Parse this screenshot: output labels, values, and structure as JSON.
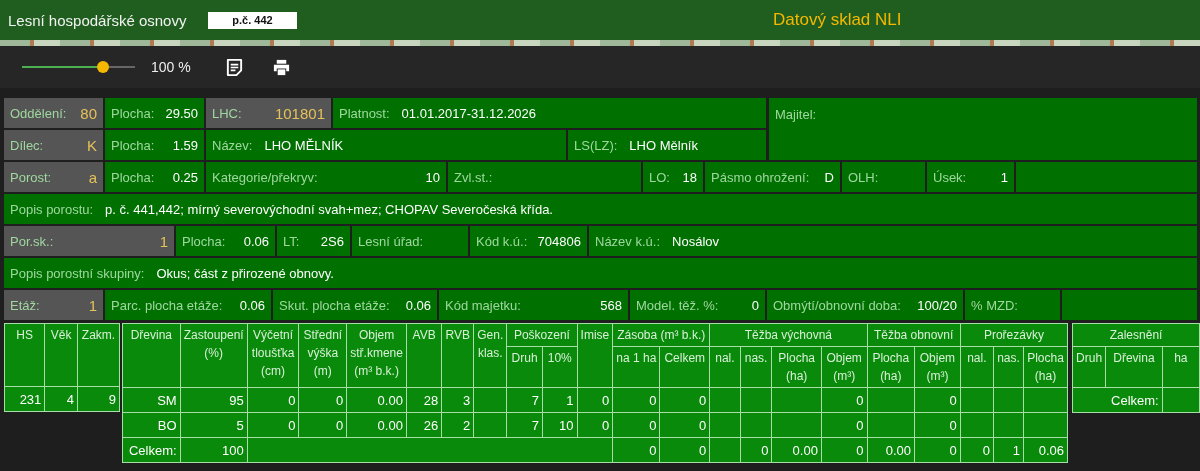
{
  "header": {
    "title": "Lesní hospodářské osnovy",
    "badge": "p.č. 442",
    "app_title": "Datový sklad NLI"
  },
  "toolbar": {
    "zoom": {
      "level": 0.72
    },
    "zoom_reading": "100 %"
  },
  "info": {
    "owner": {
      "label": "Majitel:"
    },
    "lines": [
      {
        "fields": [
          {
            "kind": "key",
            "label": "Oddělení:",
            "value": "80"
          },
          {
            "kind": "field",
            "label": "Plocha:",
            "value": "29.50"
          },
          {
            "kind": "key",
            "label": "LHC:",
            "value": "101801"
          },
          {
            "kind": "text",
            "label": "Platnost:",
            "value": "01.01.2017-31.12.2026"
          }
        ]
      },
      {
        "fields": [
          {
            "kind": "key",
            "label": "Dílec:",
            "value": "K"
          },
          {
            "kind": "field",
            "label": "Plocha:",
            "value": "1.59"
          },
          {
            "kind": "text",
            "label": "Název:",
            "value": "LHO MĚLNÍK"
          },
          {
            "kind": "text",
            "label": "LS(LZ):",
            "value": "LHO Mělník"
          }
        ]
      },
      {
        "fields": [
          {
            "kind": "key",
            "label": "Porost:",
            "value": "a"
          },
          {
            "kind": "field",
            "label": "Plocha:",
            "value": "0.25"
          },
          {
            "kind": "field",
            "label": "Kategorie/překryv:",
            "value": "10"
          },
          {
            "kind": "field",
            "label": "Zvl.st.:"
          },
          {
            "kind": "field",
            "label": "LO:",
            "value": "18"
          },
          {
            "kind": "field",
            "label": "Pásmo ohrožení:",
            "value": "D"
          },
          {
            "kind": "field",
            "label": "OLH:"
          },
          {
            "kind": "field",
            "label": "Úsek:",
            "value": "1"
          },
          {
            "kind": "empty"
          }
        ]
      },
      {
        "fields": [
          {
            "kind": "text",
            "label": "Popis porostu:",
            "value": "p. č. 441,442; mírný severovýchodní svah+mez; CHOPAV Severočeská křída."
          }
        ]
      },
      {
        "fields": [
          {
            "kind": "key",
            "label": "Por.sk.:",
            "value": "1"
          },
          {
            "kind": "field",
            "label": "Plocha:",
            "value": "0.06"
          },
          {
            "kind": "field",
            "label": "LT:",
            "value": "2S6"
          },
          {
            "kind": "field",
            "label": "Lesní úřad:"
          },
          {
            "kind": "field",
            "label": "Kód k.ú.:",
            "value": "704806"
          },
          {
            "kind": "text",
            "label": "Název k.ú.:",
            "value": "Nosálov"
          }
        ]
      },
      {
        "fields": [
          {
            "kind": "text",
            "label": "Popis porostní skupiny:",
            "value": "Okus; část z přirozené obnovy."
          }
        ]
      },
      {
        "fields": [
          {
            "kind": "key",
            "label": "Etáž:",
            "value": "1"
          },
          {
            "kind": "field",
            "label": "Parc. plocha etáže:",
            "value": "0.06"
          },
          {
            "kind": "field",
            "label": "Skut. plocha etáže:",
            "value": "0.06"
          },
          {
            "kind": "field",
            "label": "Kód majetku:",
            "value": "568"
          },
          {
            "kind": "field",
            "label": "Model. těž. %:",
            "value": "0"
          },
          {
            "kind": "field",
            "label": "Obmýtí/obnovní doba:",
            "value": "100/20"
          },
          {
            "kind": "field",
            "label": "% MZD:"
          },
          {
            "kind": "empty"
          }
        ]
      }
    ]
  },
  "stand_table": {
    "columns": [
      "HS",
      "Věk",
      "Zakm."
    ],
    "rows": [
      [
        "231",
        "4",
        "9"
      ]
    ]
  },
  "species_table": {
    "column_groups": [
      "Poškození",
      "Zásoba (m³ b.k.)",
      "Těžba výchovná",
      "Těžba obnovní",
      "Prořezávky"
    ],
    "columns": [
      {
        "kind": "single",
        "label": "Dřevina"
      },
      {
        "kind": "single",
        "label": "Zastoupení (%)"
      },
      {
        "kind": "single",
        "label": "Výčetní tloušťka (cm)"
      },
      {
        "kind": "single",
        "label": "Střední výška (m)"
      },
      {
        "kind": "single",
        "label": "Objem stř.kmene (m³ b.k.)"
      },
      {
        "kind": "single",
        "label": "AVB"
      },
      {
        "kind": "single",
        "label": "RVB"
      },
      {
        "kind": "single",
        "label": "Gen. klas."
      },
      {
        "kind": "group_first",
        "label": "Druh"
      },
      {
        "kind": "group_next",
        "label": "10%"
      },
      {
        "kind": "single",
        "label": "Imise"
      },
      {
        "kind": "group_first",
        "label": "na 1 ha"
      },
      {
        "kind": "group_next",
        "label": "Celkem"
      },
      {
        "kind": "group_first",
        "label": "nal."
      },
      {
        "kind": "group_next",
        "label": "nas."
      },
      {
        "kind": "group_next",
        "label": "Plocha (ha)"
      },
      {
        "kind": "group_next",
        "label": "Objem (m³)"
      },
      {
        "kind": "group_first",
        "label": "Plocha (ha)"
      },
      {
        "kind": "group_next",
        "label": "Objem (m³)"
      },
      {
        "kind": "group_first",
        "label": "nal."
      },
      {
        "kind": "group_next",
        "label": "nas."
      },
      {
        "kind": "group_next",
        "label": "Plocha (ha)"
      }
    ],
    "rows": [
      [
        "SM",
        "95",
        "0",
        "0",
        "0.00",
        "28",
        "3",
        null,
        "7",
        "1",
        "0",
        "0",
        "0",
        null,
        null,
        null,
        "0",
        null,
        "0",
        null,
        null,
        null
      ],
      [
        "BO",
        "5",
        "0",
        "0",
        "0.00",
        "26",
        "2",
        null,
        "7",
        "10",
        "0",
        "0",
        "0",
        null,
        null,
        null,
        "0",
        null,
        "0",
        null,
        null,
        null
      ]
    ],
    "total": {
      "cells": [
        "Celkem:",
        "100"
      ],
      "stock": [
        "0",
        "0"
      ],
      "harvest": [
        "0",
        "0.00",
        "0",
        "0.00",
        "0",
        "0",
        "1",
        "0.06"
      ]
    }
  },
  "afforestation_table": {
    "title": "Zalesnění",
    "columns": [
      "Druh",
      "Dřevina",
      "ha"
    ],
    "total_label": "Celkem:"
  }
}
